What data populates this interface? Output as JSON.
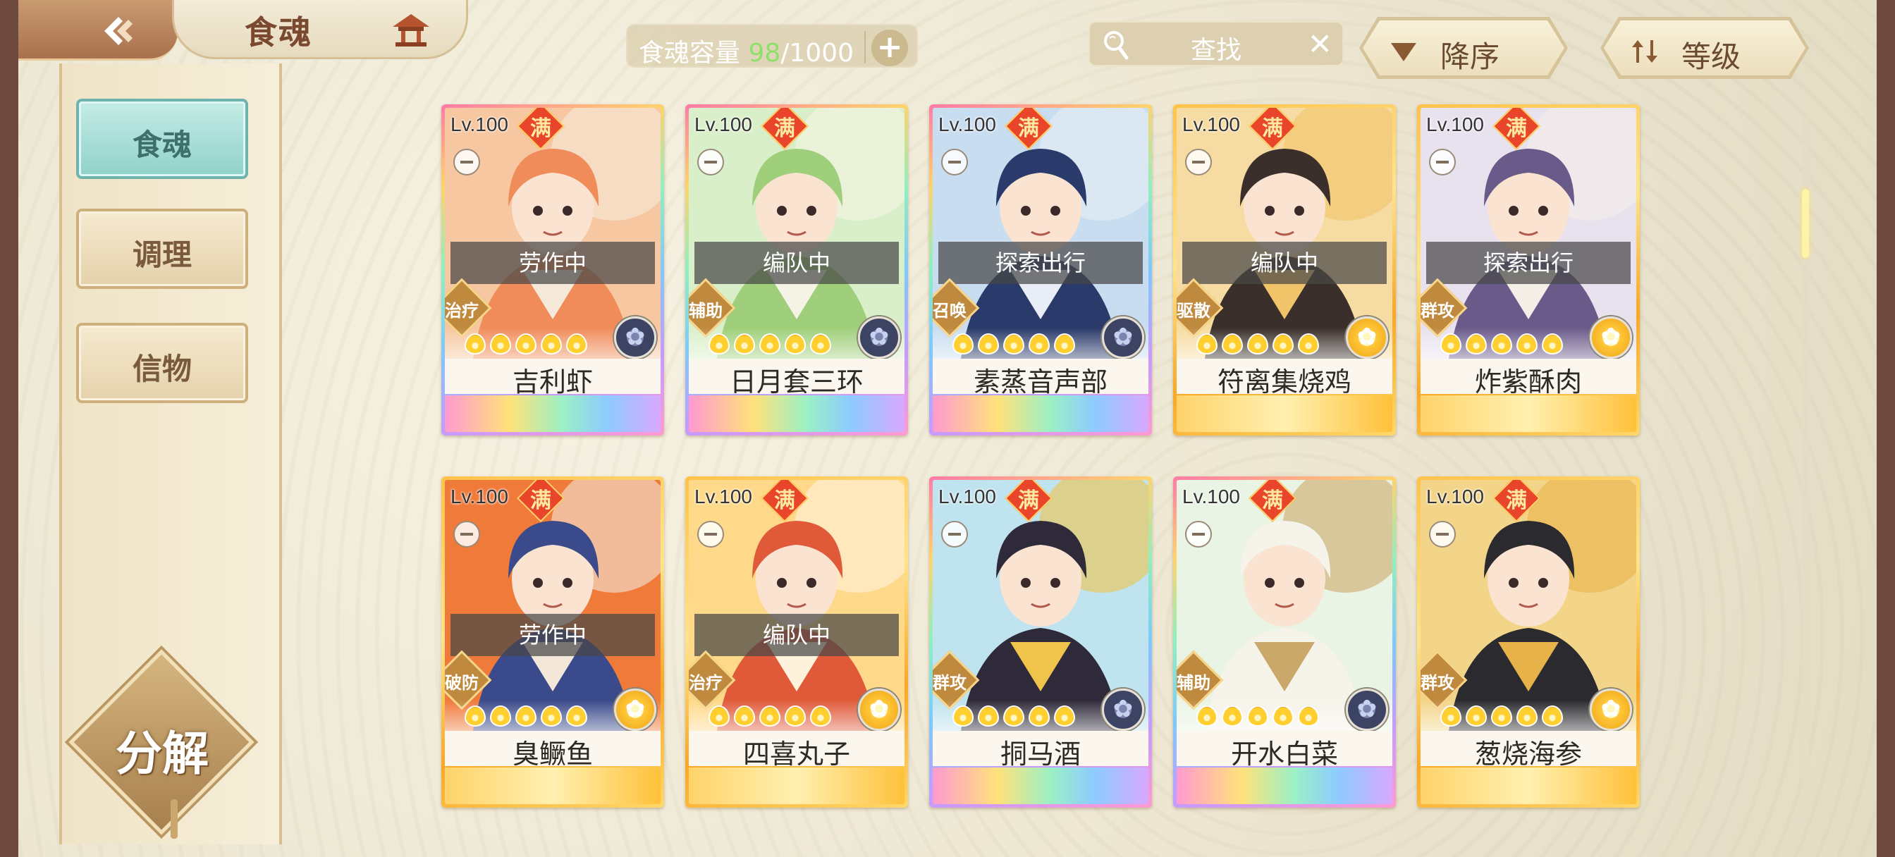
{
  "header": {
    "title": "食魂",
    "capacity_label": "食魂容量",
    "capacity_used": "98",
    "capacity_total": "/1000",
    "search_placeholder": "查找",
    "sort_order_label": "降序",
    "sort_key_label": "等级"
  },
  "sidebar": {
    "items": [
      {
        "label": "食魂",
        "active": true
      },
      {
        "label": "调理",
        "active": false
      },
      {
        "label": "信物",
        "active": false
      }
    ],
    "decompose_label": "分解"
  },
  "cards": [
    {
      "level": "Lv.100",
      "max": "满",
      "status": "劳作中",
      "role": "治疗",
      "element": "dark",
      "name": "吉利虾",
      "frame": "rainbow",
      "palette": [
        "#f6c7a0",
        "#f08c5a",
        "#f7e9d9"
      ]
    },
    {
      "level": "Lv.100",
      "max": "满",
      "status": "编队中",
      "role": "辅助",
      "element": "dark",
      "name": "日月套三环",
      "frame": "rainbow",
      "palette": [
        "#d9efc9",
        "#9fcf7a",
        "#f5f3e6"
      ]
    },
    {
      "level": "Lv.100",
      "max": "满",
      "status": "探索出行",
      "role": "召唤",
      "element": "dark",
      "name": "素蒸音声部",
      "frame": "rainbow",
      "palette": [
        "#c9ddf0",
        "#2a3a6a",
        "#e9eef6"
      ]
    },
    {
      "level": "Lv.100",
      "max": "满",
      "status": "编队中",
      "role": "驱散",
      "element": "light",
      "name": "符离集烧鸡",
      "frame": "gold",
      "palette": [
        "#f6dca2",
        "#3a2f2a",
        "#f2c46a"
      ]
    },
    {
      "level": "Lv.100",
      "max": "满",
      "status": "探索出行",
      "role": "群攻",
      "element": "light",
      "name": "炸紫酥肉",
      "frame": "gold",
      "palette": [
        "#e8e2ef",
        "#6a5a8a",
        "#f3efe7"
      ]
    },
    {
      "level": "Lv.100",
      "max": "满",
      "status": "劳作中",
      "role": "破防",
      "element": "light",
      "name": "臭鳜鱼",
      "frame": "gold",
      "palette": [
        "#f07a3a",
        "#3a4a8a",
        "#f3e7da"
      ]
    },
    {
      "level": "Lv.100",
      "max": "满",
      "status": "编队中",
      "role": "治疗",
      "element": "light",
      "name": "四喜丸子",
      "frame": "gold",
      "palette": [
        "#ffd98a",
        "#e05a3a",
        "#fff2dc"
      ]
    },
    {
      "level": "Lv.100",
      "max": "满",
      "status": "",
      "role": "群攻",
      "element": "dark",
      "name": "挏马酒",
      "frame": "rainbow",
      "palette": [
        "#bfe3ef",
        "#2f2a3a",
        "#f0c44a"
      ]
    },
    {
      "level": "Lv.100",
      "max": "满",
      "status": "",
      "role": "辅助",
      "element": "dark",
      "name": "开水白菜",
      "frame": "rainbow",
      "palette": [
        "#eaf4e4",
        "#f6f3ea",
        "#c9a86a"
      ]
    },
    {
      "level": "Lv.100",
      "max": "满",
      "status": "",
      "role": "群攻",
      "element": "light",
      "name": "葱烧海参",
      "frame": "gold",
      "palette": [
        "#f3d58a",
        "#2b2a2e",
        "#e7b24a"
      ]
    }
  ],
  "icons": {
    "back": "back-arrow-icon",
    "home": "pavilion-icon",
    "search": "magnifier-icon",
    "close": "close-icon",
    "add": "plus-icon",
    "sort_order": "descending-triangle-icon",
    "sort_key": "swap-arrows-icon"
  }
}
